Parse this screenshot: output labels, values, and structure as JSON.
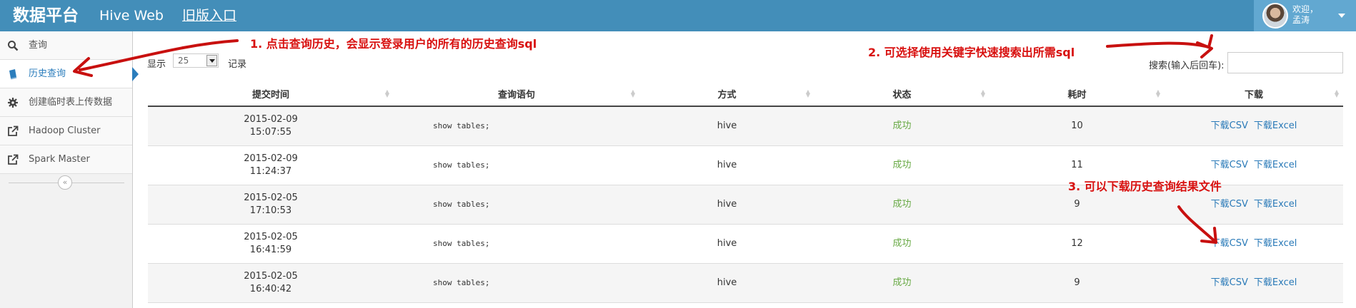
{
  "header": {
    "brand": "数据平台",
    "nav": [
      "Hive Web",
      "旧版入口"
    ],
    "user_greeting_line1": "欢迎，",
    "user_greeting_line2": "孟涛"
  },
  "sidebar": {
    "items": [
      {
        "label": "查询",
        "icon": "search-icon"
      },
      {
        "label": "历史查询",
        "icon": "book-icon"
      },
      {
        "label": "创建临时表上传数据",
        "icon": "gear-icon"
      },
      {
        "label": "Hadoop Cluster",
        "icon": "external-link-icon"
      },
      {
        "label": "Spark Master",
        "icon": "external-link-icon"
      }
    ],
    "active_index": 1,
    "collapse_glyph": "«"
  },
  "controls": {
    "show_label": "显示",
    "page_length": "25",
    "records_label": "记录",
    "search_label": "搜索(输入后回车):",
    "search_value": ""
  },
  "table": {
    "columns": [
      "提交时间",
      "查询语句",
      "方式",
      "状态",
      "耗时",
      "下载"
    ],
    "rows": [
      {
        "date": "2015-02-09",
        "time": "15:07:55",
        "sql": "show tables;",
        "mode": "hive",
        "status": "成功",
        "duration": "10",
        "csv": "下载CSV",
        "excel": "下载Excel"
      },
      {
        "date": "2015-02-09",
        "time": "11:24:37",
        "sql": "show tables;",
        "mode": "hive",
        "status": "成功",
        "duration": "11",
        "csv": "下载CSV",
        "excel": "下载Excel"
      },
      {
        "date": "2015-02-05",
        "time": "17:10:53",
        "sql": "show tables;",
        "mode": "hive",
        "status": "成功",
        "duration": "9",
        "csv": "下载CSV",
        "excel": "下载Excel"
      },
      {
        "date": "2015-02-05",
        "time": "16:41:59",
        "sql": "show tables;",
        "mode": "hive",
        "status": "成功",
        "duration": "12",
        "csv": "下载CSV",
        "excel": "下载Excel"
      },
      {
        "date": "2015-02-05",
        "time": "16:40:42",
        "sql": "show tables;",
        "mode": "hive",
        "status": "成功",
        "duration": "9",
        "csv": "下载CSV",
        "excel": "下载Excel"
      }
    ]
  },
  "annotations": {
    "note1": "1. 点击查询历史，会显示登录用户的所有的历史查询sql",
    "note2": "2. 可选择使用关键字快速搜索出所需sql",
    "note3": "3. 可以下载历史查询结果文件"
  },
  "colors": {
    "header_bg": "#438eb9",
    "accent": "#2b7dbc",
    "success": "#69aa46",
    "annotation": "#d8100f"
  }
}
